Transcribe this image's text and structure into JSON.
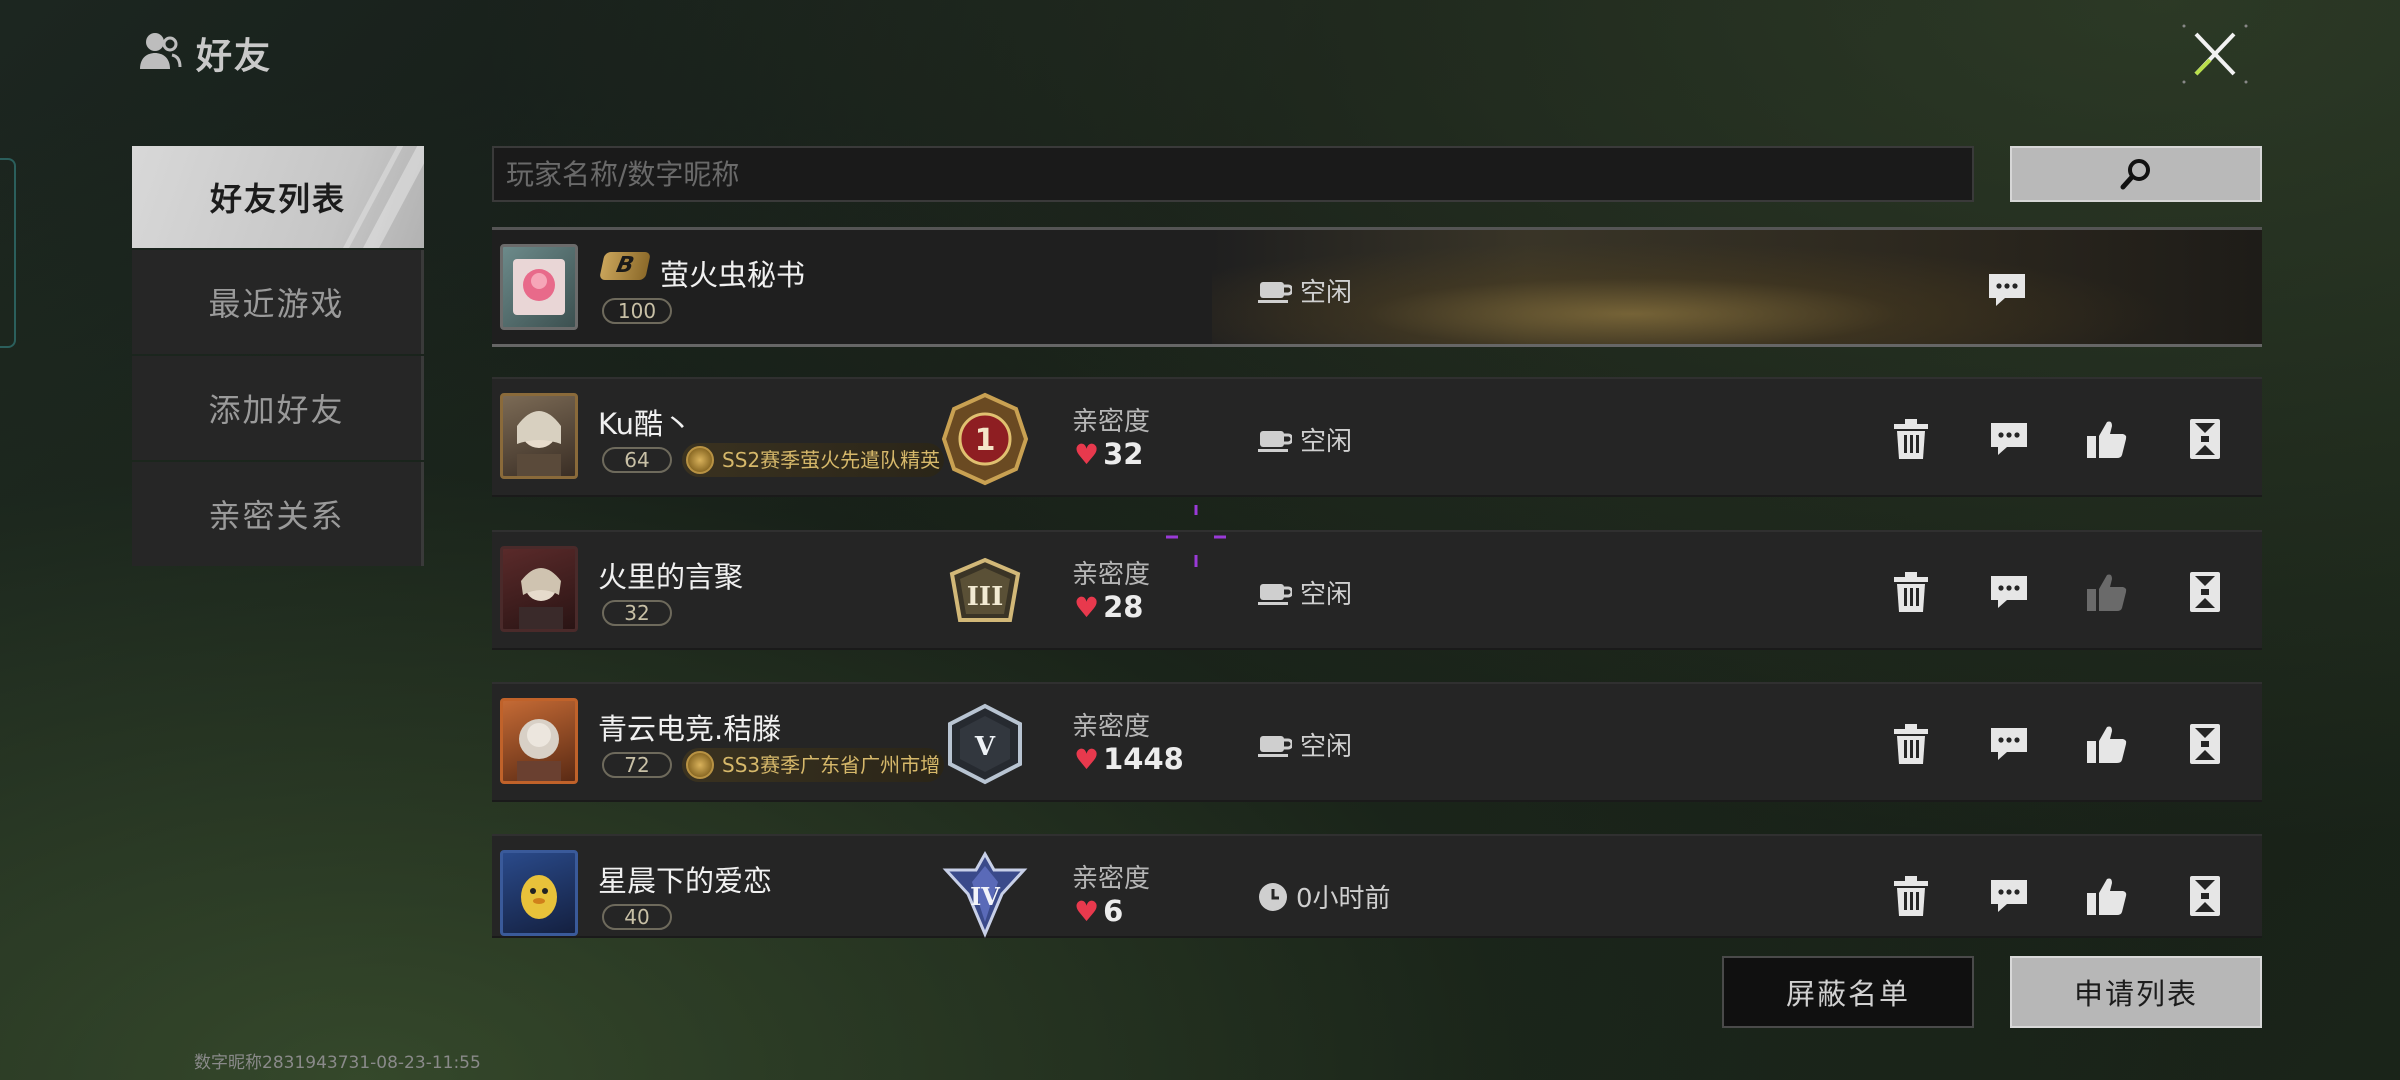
{
  "header": {
    "title": "好友"
  },
  "nav": {
    "items": [
      {
        "label": "好友列表",
        "active": true
      },
      {
        "label": "最近游戏",
        "active": false
      },
      {
        "label": "添加好友",
        "active": false
      },
      {
        "label": "亲密关系",
        "active": false
      }
    ]
  },
  "search": {
    "placeholder": "玩家名称/数字昵称",
    "value": "",
    "button_icon": "search-icon"
  },
  "intimacy_label": "亲密度",
  "friends": [
    {
      "name": "萤火虫秘书",
      "level": "100",
      "status": "空闲",
      "status_icon": "coffee-cup-icon",
      "badge": "B",
      "special": true
    },
    {
      "name": "Ku酷丶",
      "level": "64",
      "tag": "SS2赛季萤火先遣队精英",
      "rank": "1",
      "intimacy": "32",
      "status": "空闲",
      "status_icon": "coffee-cup-icon"
    },
    {
      "name": "火里的言聚",
      "level": "32",
      "rank": "III",
      "intimacy": "28",
      "status": "空闲",
      "status_icon": "coffee-cup-icon",
      "like_disabled": true
    },
    {
      "name": "青云电竞.秸滕",
      "level": "72",
      "tag": "SS3赛季广东省广州市增",
      "rank": "V",
      "intimacy": "1448",
      "status": "空闲",
      "status_icon": "coffee-cup-icon"
    },
    {
      "name": "星晨下的爱恋",
      "level": "40",
      "rank": "IV",
      "intimacy": "6",
      "status": "0小时前",
      "status_icon": "clock-icon"
    }
  ],
  "bottom": {
    "blocklist_label": "屏蔽名单",
    "requests_label": "申请列表"
  },
  "footer": {
    "id_text": "数字昵称2831943731-08-23-11:55"
  },
  "colors": {
    "heart": "#e8394d",
    "accent_gold": "#d6b86a",
    "active_tab": "#c6c6c6"
  }
}
